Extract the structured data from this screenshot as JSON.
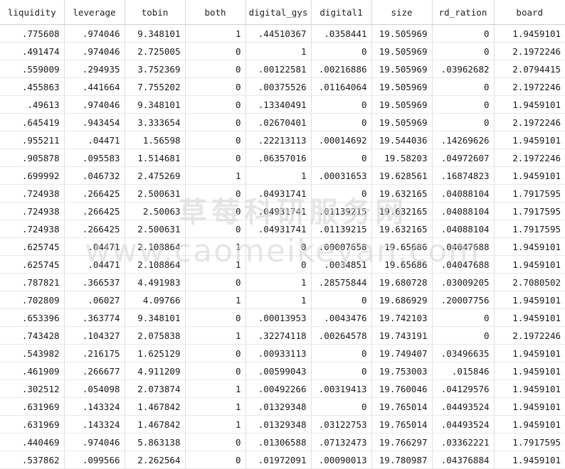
{
  "table": {
    "columns": [
      "liquidity",
      "leverage",
      "tobin",
      "both",
      "digital_gys",
      "digital1",
      "size",
      "rd_ration",
      "board"
    ],
    "rows": [
      [
        ".775608",
        ".974046",
        "9.348101",
        "1",
        ".44510367",
        ".0358441",
        "19.505969",
        "0",
        "1.9459101"
      ],
      [
        ".491474",
        ".974046",
        "2.725005",
        "0",
        "1",
        "0",
        "19.505969",
        "0",
        "2.1972246"
      ],
      [
        ".559009",
        ".294935",
        "3.752369",
        "0",
        ".00122581",
        ".00216886",
        "19.505969",
        ".03962682",
        "2.0794415"
      ],
      [
        ".455863",
        ".441664",
        "7.755202",
        "0",
        ".00375526",
        ".01164064",
        "19.505969",
        "0",
        "2.1972246"
      ],
      [
        ".49613",
        ".974046",
        "9.348101",
        "0",
        ".13340491",
        "0",
        "19.505969",
        "0",
        "1.9459101"
      ],
      [
        ".645419",
        ".943454",
        "3.333654",
        "0",
        ".02670401",
        "0",
        "19.505969",
        "0",
        "2.1972246"
      ],
      [
        ".955211",
        ".04471",
        "1.56598",
        "0",
        ".22213113",
        ".00014692",
        "19.544036",
        ".14269626",
        "1.9459101"
      ],
      [
        ".905878",
        ".095583",
        "1.514681",
        "0",
        ".06357016",
        "0",
        "19.58203",
        ".04972607",
        "2.1972246"
      ],
      [
        ".699992",
        ".046732",
        "2.475269",
        "1",
        "1",
        ".00031653",
        "19.628561",
        ".16874823",
        "1.9459101"
      ],
      [
        ".724938",
        ".266425",
        "2.500631",
        "0",
        ".04931741",
        "0",
        "19.632165",
        ".04088104",
        "1.7917595"
      ],
      [
        ".724938",
        ".266425",
        "2.50063",
        "0",
        ".04931741",
        ".01139215",
        "19.632165",
        ".04088104",
        "1.7917595"
      ],
      [
        ".724938",
        ".266425",
        "2.500631",
        "0",
        ".04931741",
        ".01139215",
        "19.632165",
        ".04088104",
        "1.7917595"
      ],
      [
        ".625745",
        ".04471",
        "2.108864",
        "1",
        "0",
        ".00007658",
        "19.65686",
        ".04047688",
        "1.9459101"
      ],
      [
        ".625745",
        ".04471",
        "2.108864",
        "1",
        "0",
        ".0034851",
        "19.65686",
        ".04047688",
        "1.9459101"
      ],
      [
        ".787821",
        ".366537",
        "4.491983",
        "0",
        "1",
        ".28575844",
        "19.680728",
        ".03009205",
        "2.7080502"
      ],
      [
        ".702809",
        ".06027",
        "4.09766",
        "1",
        "1",
        "0",
        "19.686929",
        ".20007756",
        "1.9459101"
      ],
      [
        ".653396",
        ".363774",
        "9.348101",
        "0",
        ".00013953",
        ".0043476",
        "19.742103",
        "0",
        "1.9459101"
      ],
      [
        ".743428",
        ".104327",
        "2.075838",
        "1",
        ".32274118",
        ".00264578",
        "19.743191",
        "0",
        "2.1972246"
      ],
      [
        ".543982",
        ".216175",
        "1.625129",
        "0",
        ".00933113",
        "0",
        "19.749407",
        ".03496635",
        "1.9459101"
      ],
      [
        ".461909",
        ".266677",
        "4.911209",
        "0",
        ".00599043",
        "0",
        "19.753003",
        ".015846",
        "1.9459101"
      ],
      [
        ".302512",
        ".054098",
        "2.073874",
        "1",
        ".00492266",
        ".00319413",
        "19.760046",
        ".04129576",
        "1.9459101"
      ],
      [
        ".631969",
        ".143324",
        "1.467842",
        "1",
        ".01329348",
        "0",
        "19.765014",
        ".04493524",
        "1.9459101"
      ],
      [
        ".631969",
        ".143324",
        "1.467842",
        "1",
        ".01329348",
        ".03122753",
        "19.765014",
        ".04493524",
        "1.9459101"
      ],
      [
        ".440469",
        ".974046",
        "5.863138",
        "0",
        ".01306588",
        ".07132473",
        "19.766297",
        ".03362221",
        "1.7917595"
      ],
      [
        ".537862",
        ".099566",
        "2.262564",
        "0",
        ".01972091",
        ".00090013",
        "19.780987",
        ".04376884",
        "1.9459101"
      ]
    ]
  },
  "watermark": {
    "chinese": "草莓科研服务网",
    "url": "www.caomeikeyan.com"
  }
}
